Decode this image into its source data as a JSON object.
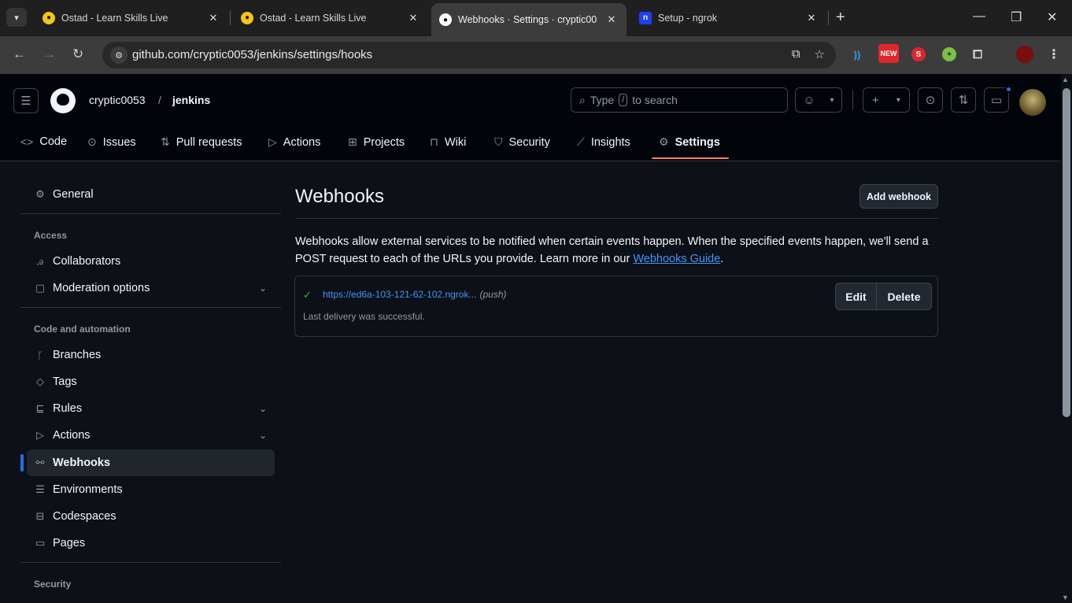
{
  "browser": {
    "tabs": [
      {
        "title": "Ostad - Learn Skills Live",
        "favicon": "ostad-icon"
      },
      {
        "title": "Ostad - Learn Skills Live",
        "favicon": "ostad-icon"
      },
      {
        "title": "Webhooks · Settings · cryptic00",
        "favicon": "github-icon"
      },
      {
        "title": "Setup - ngrok",
        "favicon": "ngrok-icon"
      }
    ],
    "url": "github.com/cryptic0053/jenkins/settings/hooks",
    "extension_badge": "NEW"
  },
  "header": {
    "owner": "cryptic0053",
    "separator": "/",
    "repo": "jenkins",
    "search": {
      "prefix": "Type",
      "key": "/",
      "suffix": "to search"
    }
  },
  "repo_nav": [
    {
      "label": "Code",
      "icon": "code-icon"
    },
    {
      "label": "Issues",
      "icon": "issue-icon"
    },
    {
      "label": "Pull requests",
      "icon": "pull-request-icon"
    },
    {
      "label": "Actions",
      "icon": "play-icon"
    },
    {
      "label": "Projects",
      "icon": "table-icon"
    },
    {
      "label": "Wiki",
      "icon": "book-icon"
    },
    {
      "label": "Security",
      "icon": "shield-icon"
    },
    {
      "label": "Insights",
      "icon": "graph-icon"
    },
    {
      "label": "Settings",
      "icon": "gear-icon",
      "selected": true
    }
  ],
  "sidebar": {
    "general": "General",
    "access_heading": "Access",
    "collaborators": "Collaborators",
    "moderation": "Moderation options",
    "code_heading": "Code and automation",
    "branches": "Branches",
    "tags": "Tags",
    "rules": "Rules",
    "actions": "Actions",
    "webhooks": "Webhooks",
    "environments": "Environments",
    "codespaces": "Codespaces",
    "pages": "Pages",
    "security_heading": "Security"
  },
  "main": {
    "title": "Webhooks",
    "add_button": "Add webhook",
    "description": "Webhooks allow external services to be notified when certain events happen. When the specified events happen, we'll send a POST request to each of the URLs you provide. Learn more in our",
    "guide_link": "Webhooks Guide",
    "period": ".",
    "hook": {
      "url": "https://ed6a-103-121-62-102.ngrok...",
      "events": "(push)",
      "status": "Last delivery was successful.",
      "edit": "Edit",
      "delete": "Delete"
    }
  },
  "colors": {
    "accent_blue": "#1f6feb",
    "link": "#4493f8",
    "success": "#3fb950",
    "tab_underline": "#f78166"
  }
}
